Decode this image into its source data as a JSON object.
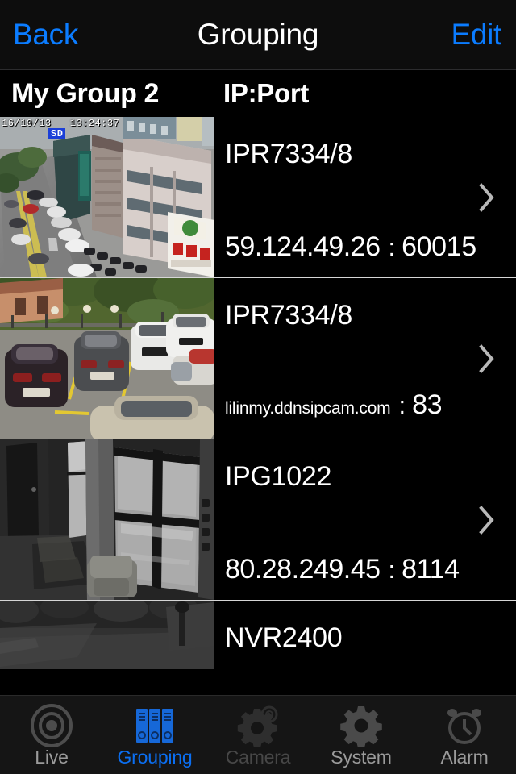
{
  "navbar": {
    "back_label": "Back",
    "title": "Grouping",
    "edit_label": "Edit"
  },
  "column_header": {
    "group_name": "My Group 2",
    "ipport_label": "IP:Port"
  },
  "list": {
    "rows": [
      {
        "model": "IPR7334/8",
        "host": "59.124.49.26",
        "colon": ":",
        "port": "60015",
        "host_small": false,
        "overlay_timestamp": "16/10/13   13:24:37",
        "overlay_badge": "SD",
        "chevron": "chevron-right-icon"
      },
      {
        "model": "IPR7334/8",
        "host": "lilinmy.ddnsipcam.com",
        "colon": ":",
        "port": "83",
        "host_small": true,
        "overlay_timestamp": "",
        "overlay_badge": "",
        "chevron": "chevron-right-icon"
      },
      {
        "model": "IPG1022",
        "host": "80.28.249.45",
        "colon": ":",
        "port": "8114",
        "host_small": false,
        "overlay_timestamp": "",
        "overlay_badge": "",
        "chevron": "chevron-right-icon"
      },
      {
        "model": "NVR2400",
        "host": "",
        "colon": "",
        "port": "",
        "host_small": false,
        "overlay_timestamp": "",
        "overlay_badge": "",
        "chevron": ""
      }
    ]
  },
  "tabbar": {
    "items": [
      {
        "label": "Live",
        "icon": "live-target-icon",
        "state": "inactive"
      },
      {
        "label": "Grouping",
        "icon": "binders-icon",
        "state": "active"
      },
      {
        "label": "Camera",
        "icon": "camera-gear-icon",
        "state": "disabled"
      },
      {
        "label": "System",
        "icon": "gear-icon",
        "state": "inactive"
      },
      {
        "label": "Alarm",
        "icon": "alarm-clock-icon",
        "state": "inactive"
      }
    ]
  },
  "colors": {
    "accent_blue": "#0b7cff",
    "tab_active_blue": "#0b6ff2",
    "background": "#000000",
    "navbar_bg": "#0d0d0d",
    "tabbar_bg": "#151515",
    "separator": "#d6d6d6",
    "chevron_gray": "#b8b8b8"
  }
}
